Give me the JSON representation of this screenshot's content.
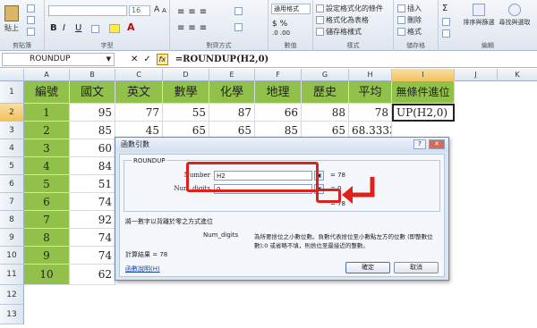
{
  "ribbon": {
    "paste": "貼上",
    "group_clipboard": "剪貼簿",
    "group_font": "字型",
    "group_align": "對齊方式",
    "group_number": "數值",
    "group_styles": "樣式",
    "group_cells": "儲存格",
    "group_edit": "編輯",
    "font_size": "16",
    "number_format": "通用格式",
    "cond_format": "設定格式化的條件",
    "format_table": "格式化為表格",
    "cell_styles": "儲存格樣式",
    "insert": "插入",
    "delete": "刪除",
    "format": "格式",
    "sort_filter": "排序與篩選",
    "find_select": "尋找與選取",
    "bold": "B",
    "italic": "I",
    "underline": "U"
  },
  "formula_bar": {
    "name_box": "ROUNDUP",
    "cancel": "✕",
    "enter": "✓",
    "fx": "fx",
    "formula": "=ROUNDUP(H2,0)"
  },
  "columns": [
    "A",
    "B",
    "C",
    "D",
    "E",
    "F",
    "G",
    "H",
    "I",
    "J",
    "K"
  ],
  "rows": [
    "1",
    "2",
    "3",
    "4",
    "5",
    "6",
    "7",
    "8",
    "9",
    "10",
    "11",
    "12",
    "13"
  ],
  "headers": [
    "編號",
    "國文",
    "英文",
    "數學",
    "化學",
    "地理",
    "歷史",
    "平均",
    "無條件進位"
  ],
  "data": [
    [
      "1",
      "95",
      "77",
      "55",
      "87",
      "66",
      "88",
      "78",
      "UP(H2,0)"
    ],
    [
      "2",
      "85",
      "45",
      "65",
      "65",
      "85",
      "65",
      "68.33333",
      ""
    ],
    [
      "3",
      "60",
      "",
      "",
      "",
      "",
      "",
      "",
      ""
    ],
    [
      "4",
      "84",
      "",
      "",
      "",
      "",
      "",
      "",
      ""
    ],
    [
      "5",
      "51",
      "",
      "",
      "",
      "",
      "",
      "",
      ""
    ],
    [
      "6",
      "74",
      "",
      "",
      "",
      "",
      "",
      "",
      ""
    ],
    [
      "7",
      "92",
      "",
      "",
      "",
      "",
      "",
      "",
      ""
    ],
    [
      "8",
      "74",
      "",
      "",
      "",
      "",
      "",
      "",
      ""
    ],
    [
      "9",
      "74",
      "",
      "",
      "",
      "",
      "",
      "",
      ""
    ],
    [
      "10",
      "62",
      "",
      "",
      "",
      "",
      "",
      "",
      ""
    ]
  ],
  "dialog": {
    "title": "函數引數",
    "func_name": "ROUNDUP",
    "arg1_label": "Number",
    "arg1_value": "H2",
    "arg1_result": "= 78",
    "arg2_label": "Num_digits",
    "arg2_value": "0",
    "arg2_result": "= 0",
    "total_result": "= 78",
    "description": "將一數字以背離於零之方式進位",
    "arg_desc_label": "Num_digits",
    "arg_desc_line1": "為所要捨位之小數位數。負數代表捨位至小數點左方的位數 (即整數位",
    "arg_desc_line2": "數);0 或省略不填，則捨位至最接近的整數。",
    "calc_result": "計算結果 =   78",
    "help_link": "函數說明(H)",
    "ok": "確定",
    "cancel": "取消",
    "help_btn": "?",
    "close_btn": "✕"
  },
  "annotation_color": "#e0201a"
}
